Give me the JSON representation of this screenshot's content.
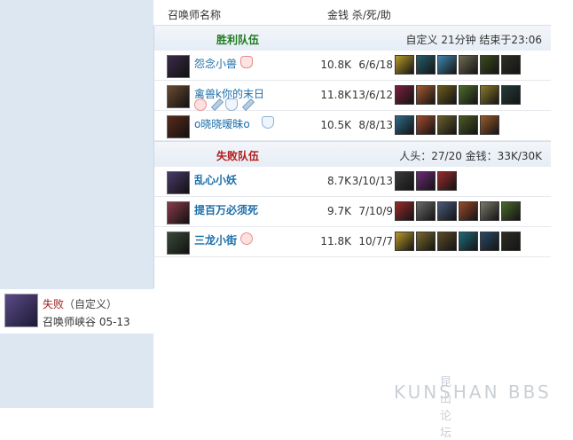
{
  "header": {
    "summoner_label": "召唤师名称",
    "gold_kda_label": "金钱 杀/死/助"
  },
  "win_team": {
    "name": "胜利队伍",
    "info": "自定义 21分钟 结束于23:06"
  },
  "lose_team": {
    "name": "失败队伍",
    "info": "人头：27/20 金钱：33K/30K"
  },
  "win_players": [
    {
      "name": "怨念小兽",
      "gold": "10.8K",
      "kda": "6/6/18",
      "badges": [
        "hand-icon"
      ],
      "items": [
        "#b99a2a",
        "#245f6d",
        "#3e86b0",
        "#6e6a52",
        "#3a4b1e",
        "#2e2e26"
      ]
    },
    {
      "name": "禽兽k你的末日",
      "gold": "11.8K",
      "kda": "13/6/12",
      "badges": [
        "heart-icon",
        "sword-icon",
        "shield-icon",
        "sword-icon"
      ],
      "items": [
        "#7a1f3d",
        "#a55a2d",
        "#6b5a1e",
        "#4d6b2a",
        "#8a7a2a",
        "#243b3a"
      ]
    },
    {
      "name": "o晓晓暧昧o",
      "gold": "10.5K",
      "kda": "8/8/13",
      "badges": [
        "shield-icon"
      ],
      "items": [
        "#2d6a8a",
        "#a34a2b",
        "#6a5e2a",
        "#4a5a22",
        "#9a5a2a"
      ]
    }
  ],
  "lose_players": [
    {
      "name": "乱心小妖",
      "gold": "8.7K",
      "kda": "3/10/13",
      "badges": [],
      "items": [
        "#3a3a3a",
        "#6e2a7a",
        "#9a2a2a"
      ]
    },
    {
      "name": "提百万必须死",
      "gold": "9.7K",
      "kda": "7/10/9",
      "badges": [],
      "items": [
        "#9a2a2a",
        "#6b6b6b",
        "#4a5a7a",
        "#9a4a2a",
        "#7a7a6a",
        "#4a6a2a"
      ]
    },
    {
      "name": "三龙小街",
      "gold": "11.8K",
      "kda": "10/7/7",
      "badges": [
        "heart-icon"
      ],
      "items": [
        "#b99a2a",
        "#7a6a2a",
        "#5a4a2a",
        "#1f6a7a",
        "#2a4a6a",
        "#2e2e26"
      ]
    }
  ],
  "last_game": {
    "result": "失败",
    "mode": "（自定义）",
    "map_date": "召唤师峡谷 05-13"
  },
  "watermark": {
    "cn": "昆山论坛",
    "en": "KUNSHAN BBS"
  }
}
